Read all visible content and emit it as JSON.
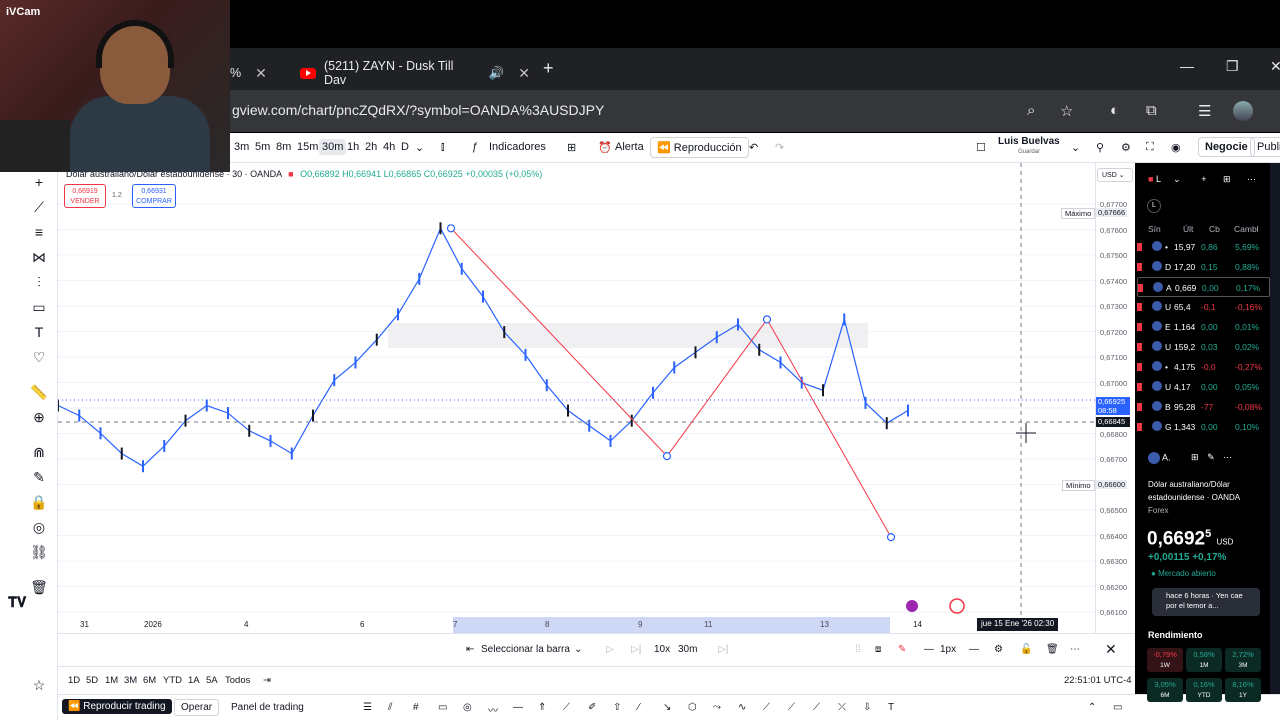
{
  "webcam": {
    "label": "iVCam"
  },
  "browser": {
    "active_tab_fragment": "%",
    "youtube_tab_title": "(5211) ZAYN - Dusk Till Dav",
    "url": "gview.com/chart/pncZQdRX/?symbol=OANDA%3AUSDJPY",
    "new_tab": "+",
    "minimize": "—",
    "restore": "❐",
    "close": "✕"
  },
  "tv_toolbar": {
    "intervals": [
      "3m",
      "5m",
      "8m",
      "15m",
      "30m",
      "1h",
      "2h",
      "4h",
      "D"
    ],
    "selected_interval": "30m",
    "indicators": "Indicadores",
    "alert": "Alerta",
    "replay": "Reproducción",
    "user": "Luis Buelvas",
    "user_sub": "Guardar",
    "trade": "Negocie",
    "publish": "Public"
  },
  "legend": {
    "symbol": "Dólar australiano/Dólar estadounidense · 30 · OANDA",
    "ohlc": "O0,66892 H0,66941 L0,66865 C0,66925 +0,00035 (+0,05%)",
    "sell_price": "0,66919",
    "sell_label": "VENDER",
    "spread": "1.2",
    "buy_price": "0,66931",
    "buy_label": "COMPRAR"
  },
  "chart_data": {
    "type": "line",
    "title": "Dólar australiano/Dólar estadounidense · 30 · OANDA",
    "currency": "USD",
    "y_ticks": [
      "0,67700",
      "0,67600",
      "0,67500",
      "0,67400",
      "0,67300",
      "0,67200",
      "0,67100",
      "0,67000",
      "0,66900",
      "0,66800",
      "0,66700",
      "0,66600",
      "0,66500",
      "0,66400",
      "0,66300",
      "0,66200",
      "0,66100"
    ],
    "x_ticks": [
      "31",
      "2026",
      "4",
      "6",
      "7",
      "8",
      "9",
      "11",
      "13",
      "14"
    ],
    "ylim": [
      0.661,
      0.6772
    ],
    "max_label": "Máximo",
    "max_value": "0,67666",
    "min_label": "Mínimo",
    "min_value": "0,66600",
    "current_price": "0,66925",
    "countdown": "08:58",
    "crosshair_price": "0,66845",
    "time_tag": "jue 15 Ene '26  02:30",
    "series": [
      {
        "name": "price",
        "values": [
          0.6692,
          0.6688,
          0.6681,
          0.6673,
          0.6668,
          0.6676,
          0.6686,
          0.6692,
          0.6689,
          0.6682,
          0.6678,
          0.6673,
          0.6688,
          0.6702,
          0.6709,
          0.6718,
          0.6728,
          0.6742,
          0.6762,
          0.6746,
          0.6735,
          0.6721,
          0.6712,
          0.67,
          0.669,
          0.6684,
          0.6678,
          0.6686,
          0.6697,
          0.6707,
          0.6713,
          0.6719,
          0.6724,
          0.6714,
          0.6709,
          0.6701,
          0.6698,
          0.6726,
          0.6693,
          0.6685,
          0.669
        ]
      }
    ],
    "pattern_points": [
      {
        "label": "7",
        "y": 0.6762
      },
      {
        "label": "9-10",
        "y": 0.6672
      },
      {
        "label": "12",
        "y": 0.6726
      },
      {
        "label": "14",
        "y": 0.664
      }
    ]
  },
  "time_axis": [
    "31",
    "2026",
    "4",
    "6",
    "7",
    "8",
    "9",
    "11",
    "13",
    "14"
  ],
  "replay_bar": {
    "select_bar": "Seleccionar la barra",
    "speed": "10x",
    "interval": "30m"
  },
  "range_bar": {
    "ranges": [
      "1D",
      "5D",
      "1M",
      "3M",
      "6M",
      "YTD",
      "1A",
      "5A",
      "Todos"
    ],
    "clock": "22:51:01 UTC-4"
  },
  "bottom_bar": {
    "replay_trading": "Reproducir trading",
    "operate": "Operar",
    "trading_panel": "Panel de trading",
    "drawing_size": "1px"
  },
  "watchlist": {
    "title": "L",
    "section": "L",
    "columns": [
      "Sín",
      "Últ",
      "Cb",
      "Cambl"
    ],
    "rows": [
      {
        "sym": "•",
        "last": "15,97",
        "chg": "0,86",
        "pct": "5,69%",
        "dir": "pos"
      },
      {
        "sym": "D",
        "last": "17,20",
        "chg": "0,15",
        "pct": "0,88%",
        "dir": "pos"
      },
      {
        "sym": "A",
        "last": "0,669",
        "chg": "0,00",
        "pct": "0,17%",
        "dir": "pos"
      },
      {
        "sym": "U",
        "last": "65,4",
        "chg": "-0,1",
        "pct": "-0,16%",
        "dir": "neg"
      },
      {
        "sym": "E",
        "last": "1,164",
        "chg": "0,00",
        "pct": "0,01%",
        "dir": "pos"
      },
      {
        "sym": "U",
        "last": "159,2",
        "chg": "0,03",
        "pct": "0,02%",
        "dir": "pos"
      },
      {
        "sym": "•",
        "last": "4,175",
        "chg": "-0,0",
        "pct": "-0,27%",
        "dir": "neg"
      },
      {
        "sym": "U",
        "last": "4,17",
        "chg": "0,00",
        "pct": "0,05%",
        "dir": "pos"
      },
      {
        "sym": "B",
        "last": "95,28",
        "chg": "-77",
        "pct": "-0,08%",
        "dir": "neg"
      },
      {
        "sym": "G",
        "last": "1,343",
        "chg": "0,00",
        "pct": "0,10%",
        "dir": "pos"
      }
    ],
    "detail_header": "A.",
    "detail_name": "Dólar australiano/Dólar estadounidense",
    "detail_exchange": "OANDA",
    "detail_type": "Forex",
    "big_price": "0,6692",
    "big_price_sup": "5",
    "big_price_unit": "USD",
    "change": "+0,00115 +0,17%",
    "market_status": "Mercado abierto",
    "news": "hace 6 horas · Yen cae por el temor a...",
    "performance_title": "Rendimiento",
    "performance": [
      {
        "val": "-0,79%",
        "label": "1W",
        "dir": "neg"
      },
      {
        "val": "0,58%",
        "label": "1M",
        "dir": "pos"
      },
      {
        "val": "2,72%",
        "label": "3M",
        "dir": "pos"
      },
      {
        "val": "3,05%",
        "label": "6M",
        "dir": "pos"
      },
      {
        "val": "0,16%",
        "label": "YTD",
        "dir": "pos"
      },
      {
        "val": "8,16%",
        "label": "1Y",
        "dir": "pos"
      }
    ]
  }
}
